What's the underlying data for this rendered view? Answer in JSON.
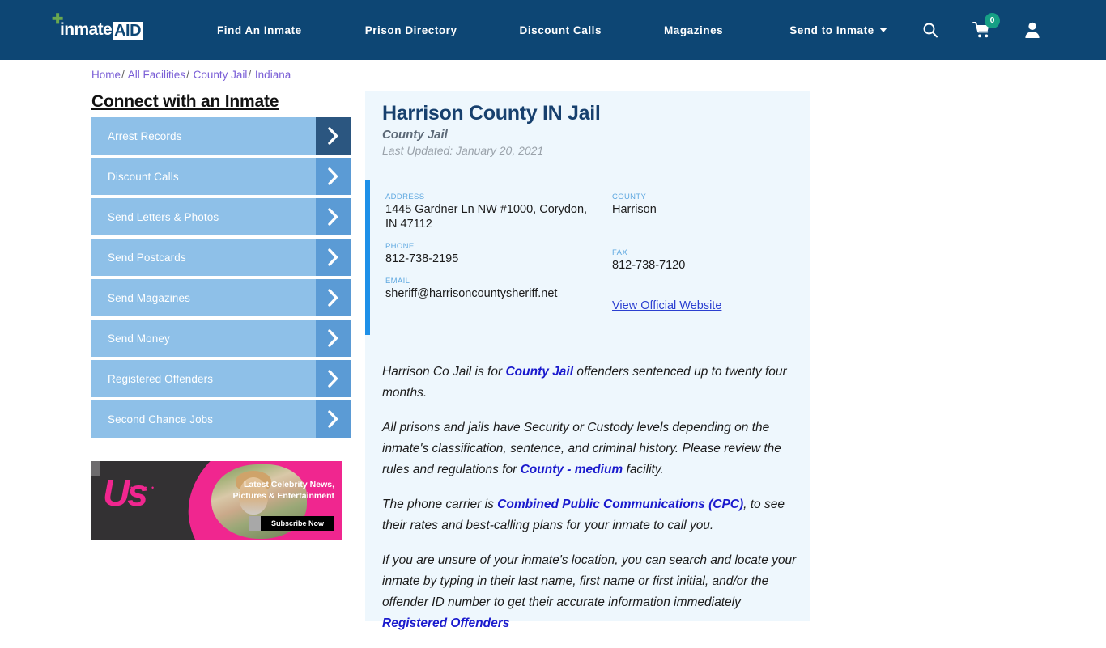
{
  "header": {
    "logo": {
      "word": "inmate",
      "aid": "AID",
      "plus_icon": "green-plus-icon"
    },
    "nav": [
      {
        "label": "Find An Inmate"
      },
      {
        "label": "Prison Directory"
      },
      {
        "label": "Discount Calls"
      },
      {
        "label": "Magazines"
      },
      {
        "label": "Send to Inmate"
      }
    ],
    "icons": {
      "search": "search-icon",
      "cart": "cart-icon",
      "cart_badge": "0",
      "account": "user-account-icon"
    },
    "bg_color": "#0d4674"
  },
  "breadcrumb": {
    "items": [
      "Home",
      "All Facilities",
      "County Jail",
      "Indiana"
    ],
    "separator": "/"
  },
  "sidebar": {
    "title": "Connect with an Inmate",
    "items": [
      {
        "label": "Arrest Records"
      },
      {
        "label": "Discount Calls"
      },
      {
        "label": "Send Letters & Photos"
      },
      {
        "label": "Send Postcards"
      },
      {
        "label": "Send Magazines"
      },
      {
        "label": "Send Money"
      },
      {
        "label": "Registered Offenders"
      },
      {
        "label": "Second Chance Jobs"
      }
    ],
    "item_color": "#8ec0e8",
    "arrow_color": "#5b9bd5",
    "arrow_active_color": "#2b5680"
  },
  "ad": {
    "brand": "Us",
    "brand_dots": "• • • •",
    "copy": "Latest Celebrity News, Pictures & Entertainment",
    "cta": "Subscribe Now"
  },
  "facility": {
    "title": "Harrison County IN Jail",
    "subtitle": "County Jail",
    "last_updated": "Last Updated: January 20, 2021",
    "fields": {
      "address_label": "ADDRESS",
      "address_value": "1445 Gardner Ln NW #1000, Corydon, IN 47112",
      "county_label": "COUNTY",
      "county_value": "Harrison",
      "phone_label": "PHONE",
      "phone_value": "812-738-2195",
      "fax_label": "FAX",
      "fax_value": "812-738-7120",
      "email_label": "EMAIL",
      "email_value": "sheriff@harrisoncountysheriff.net",
      "website_link": "View Official Website"
    },
    "accent_color": "#1e90e8",
    "panel_bg": "#eef7fd"
  },
  "body": {
    "p1_a": "Harrison Co Jail is for ",
    "p1_link": "County Jail",
    "p1_b": " offenders sentenced up to twenty four months.",
    "p2_a": "All prisons and jails have Security or Custody levels depending on the inmate's classification, sentence, and criminal history. Please review the rules and regulations for ",
    "p2_link": "County - medium",
    "p2_b": " facility.",
    "p3_a": "The phone carrier is ",
    "p3_link": "Combined Public Communications (CPC)",
    "p3_b": ", to see their rates and best-calling plans for your inmate to call you.",
    "p4_a": "If you are unsure of your inmate's location, you can search and locate your inmate by typing in their last name, first name or first initial, and/or the offender ID number to get their accurate information immediately ",
    "p4_link": "Registered Offenders"
  }
}
